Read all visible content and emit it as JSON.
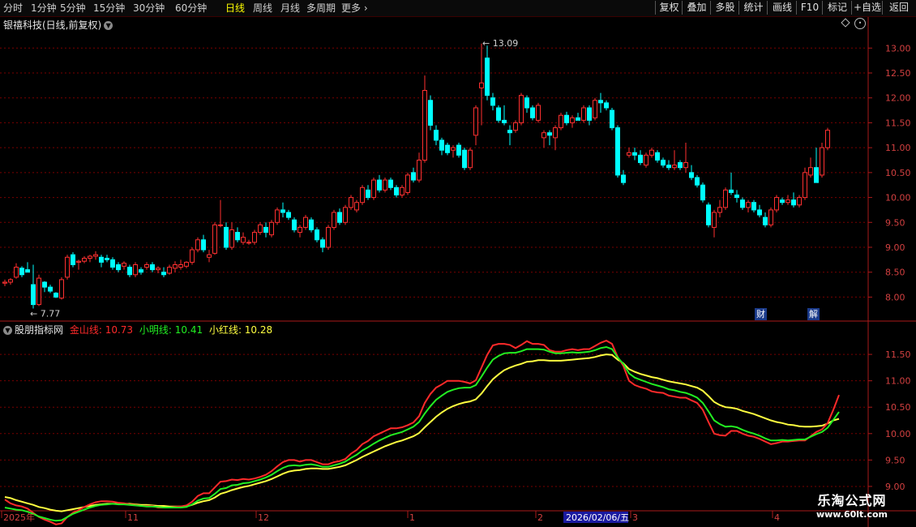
{
  "toolbar": {
    "periods": [
      "分时",
      "1分钟",
      "5分钟",
      "15分钟",
      "30分钟",
      "60分钟",
      "日线",
      "周线",
      "月线",
      "多周期",
      "更多"
    ],
    "active_period": "日线",
    "buttons": [
      "复权",
      "叠加",
      "多股",
      "统计",
      "画线",
      "F10",
      "标记",
      "+自选",
      "返回"
    ]
  },
  "stock": {
    "title": "银禧科技(日线,前复权)"
  },
  "price_axis": {
    "ticks": [
      "13.00",
      "12.50",
      "12.00",
      "11.50",
      "11.00",
      "10.50",
      "10.00",
      "9.50",
      "9.00",
      "8.50",
      "8.00"
    ],
    "min": 7.6,
    "max": 13.2
  },
  "annotations": {
    "high": "13.09",
    "low": "7.77"
  },
  "badges": [
    "财",
    "解"
  ],
  "indicator": {
    "name": "股朋指标网",
    "lines": [
      {
        "label": "金山线: 10.73",
        "color": "#ff2a2a"
      },
      {
        "label": "小明线: 10.41",
        "color": "#22ee22"
      },
      {
        "label": "小红线: 10.28",
        "color": "#ffff40"
      }
    ],
    "ticks": [
      "11.50",
      "11.00",
      "10.50",
      "10.00",
      "9.50",
      "9.00"
    ],
    "min": 8.6,
    "max": 12.1
  },
  "date_axis": {
    "labels": [
      "2025年",
      "11",
      "12",
      "1",
      "2",
      "3",
      "4"
    ],
    "cursor_date": "2026/02/06/五"
  },
  "watermark": {
    "line1": "乐淘公式网",
    "line2": "www.60lt.com"
  },
  "colors": {
    "up": "#ff3030",
    "down": "#00ffff",
    "grid": "#7a0000",
    "axis": "#aa1a1a"
  },
  "chart_data": {
    "type": "candlestick",
    "ohlc": [
      [
        8.28,
        8.35,
        8.22,
        8.3
      ],
      [
        8.3,
        8.38,
        8.25,
        8.35
      ],
      [
        8.4,
        8.68,
        8.37,
        8.6
      ],
      [
        8.58,
        8.62,
        8.4,
        8.45
      ],
      [
        8.55,
        8.7,
        8.5,
        8.5
      ],
      [
        8.25,
        8.65,
        7.77,
        7.85
      ],
      [
        7.85,
        8.45,
        7.82,
        8.38
      ],
      [
        8.3,
        8.32,
        8.1,
        8.2
      ],
      [
        8.2,
        8.25,
        8.08,
        8.12
      ],
      [
        8.08,
        8.1,
        7.98,
        8.0
      ],
      [
        7.98,
        8.4,
        7.95,
        8.35
      ],
      [
        8.4,
        8.85,
        8.35,
        8.8
      ],
      [
        8.85,
        8.9,
        8.6,
        8.65
      ],
      [
        8.7,
        8.75,
        8.55,
        8.72
      ],
      [
        8.72,
        8.82,
        8.68,
        8.78
      ],
      [
        8.78,
        8.85,
        8.7,
        8.82
      ],
      [
        8.82,
        8.92,
        8.75,
        8.85
      ],
      [
        8.8,
        8.85,
        8.6,
        8.7
      ],
      [
        8.78,
        8.85,
        8.7,
        8.75
      ],
      [
        8.75,
        8.8,
        8.55,
        8.6
      ],
      [
        8.65,
        8.7,
        8.5,
        8.55
      ],
      [
        8.62,
        8.72,
        8.55,
        8.68
      ],
      [
        8.6,
        8.65,
        8.4,
        8.45
      ],
      [
        8.45,
        8.7,
        8.4,
        8.65
      ],
      [
        8.55,
        8.6,
        8.45,
        8.5
      ],
      [
        8.6,
        8.7,
        8.55,
        8.65
      ],
      [
        8.65,
        8.7,
        8.5,
        8.55
      ],
      [
        8.55,
        8.62,
        8.48,
        8.58
      ],
      [
        8.5,
        8.6,
        8.4,
        8.45
      ],
      [
        8.48,
        8.65,
        8.45,
        8.6
      ],
      [
        8.58,
        8.72,
        8.5,
        8.65
      ],
      [
        8.6,
        8.75,
        8.55,
        8.65
      ],
      [
        8.62,
        8.72,
        8.58,
        8.7
      ],
      [
        8.7,
        9.0,
        8.65,
        8.95
      ],
      [
        8.95,
        9.2,
        8.9,
        9.15
      ],
      [
        9.15,
        9.25,
        8.9,
        8.95
      ],
      [
        8.8,
        8.95,
        8.7,
        8.85
      ],
      [
        8.88,
        9.5,
        8.85,
        9.45
      ],
      [
        9.45,
        9.95,
        9.4,
        9.45
      ],
      [
        9.4,
        9.5,
        8.95,
        9.0
      ],
      [
        9.0,
        9.5,
        8.95,
        9.35
      ],
      [
        9.3,
        9.4,
        9.1,
        9.15
      ],
      [
        9.1,
        9.3,
        9.05,
        9.2
      ],
      [
        9.1,
        9.15,
        9.05,
        9.1
      ],
      [
        9.1,
        9.35,
        9.05,
        9.3
      ],
      [
        9.3,
        9.5,
        9.25,
        9.45
      ],
      [
        9.4,
        9.5,
        9.2,
        9.3
      ],
      [
        9.25,
        9.55,
        9.2,
        9.5
      ],
      [
        9.5,
        9.8,
        9.45,
        9.75
      ],
      [
        9.75,
        9.9,
        9.6,
        9.7
      ],
      [
        9.7,
        9.75,
        9.55,
        9.6
      ],
      [
        9.55,
        9.6,
        9.3,
        9.35
      ],
      [
        9.3,
        9.45,
        9.2,
        9.4
      ],
      [
        9.4,
        9.65,
        9.35,
        9.6
      ],
      [
        9.55,
        9.6,
        9.3,
        9.35
      ],
      [
        9.35,
        9.4,
        9.1,
        9.15
      ],
      [
        9.15,
        9.2,
        8.9,
        9.0
      ],
      [
        9.0,
        9.45,
        8.95,
        9.4
      ],
      [
        9.4,
        9.75,
        9.35,
        9.7
      ],
      [
        9.7,
        9.78,
        9.45,
        9.5
      ],
      [
        9.5,
        9.85,
        9.45,
        9.8
      ],
      [
        9.8,
        10.05,
        9.75,
        10.0
      ],
      [
        9.75,
        9.95,
        9.7,
        9.9
      ],
      [
        9.9,
        10.25,
        9.85,
        10.2
      ],
      [
        10.15,
        10.25,
        9.95,
        10.0
      ],
      [
        10.0,
        10.4,
        9.95,
        10.35
      ],
      [
        10.35,
        10.45,
        10.1,
        10.15
      ],
      [
        10.15,
        10.4,
        10.1,
        10.35
      ],
      [
        10.35,
        10.4,
        10.15,
        10.2
      ],
      [
        10.2,
        10.25,
        10.0,
        10.05
      ],
      [
        10.05,
        10.25,
        10.0,
        10.2
      ],
      [
        10.1,
        10.5,
        10.05,
        10.45
      ],
      [
        10.5,
        10.6,
        10.3,
        10.35
      ],
      [
        10.35,
        10.9,
        10.3,
        10.75
      ],
      [
        10.75,
        12.45,
        10.7,
        12.15
      ],
      [
        11.95,
        12.05,
        11.35,
        11.45
      ],
      [
        11.35,
        11.45,
        11.05,
        11.15
      ],
      [
        11.15,
        11.2,
        10.85,
        10.95
      ],
      [
        11.05,
        11.1,
        10.85,
        10.9
      ],
      [
        10.95,
        11.05,
        10.8,
        11.0
      ],
      [
        11.05,
        11.1,
        10.8,
        10.85
      ],
      [
        10.95,
        11.0,
        10.55,
        10.6
      ],
      [
        10.6,
        11.0,
        10.55,
        10.95
      ],
      [
        11.25,
        11.85,
        11.05,
        11.8
      ],
      [
        12.2,
        13.09,
        11.45,
        12.3
      ],
      [
        12.8,
        13.05,
        11.95,
        12.05
      ],
      [
        12.0,
        12.1,
        11.75,
        11.85
      ],
      [
        11.8,
        11.85,
        11.5,
        11.55
      ],
      [
        11.55,
        11.85,
        11.45,
        11.5
      ],
      [
        11.35,
        11.45,
        11.05,
        11.3
      ],
      [
        11.35,
        11.55,
        11.3,
        11.5
      ],
      [
        11.5,
        12.1,
        11.45,
        12.05
      ],
      [
        12.0,
        12.05,
        11.7,
        11.8
      ],
      [
        11.8,
        11.85,
        11.55,
        11.6
      ],
      [
        11.55,
        11.9,
        11.5,
        11.85
      ],
      [
        11.2,
        11.35,
        11.0,
        11.3
      ],
      [
        11.3,
        11.35,
        11.05,
        11.25
      ],
      [
        11.2,
        11.45,
        10.95,
        11.4
      ],
      [
        11.4,
        11.7,
        11.35,
        11.65
      ],
      [
        11.65,
        11.72,
        11.45,
        11.5
      ],
      [
        11.5,
        11.65,
        11.4,
        11.6
      ],
      [
        11.6,
        11.7,
        11.55,
        11.55
      ],
      [
        11.55,
        11.85,
        11.5,
        11.8
      ],
      [
        11.8,
        11.85,
        11.45,
        11.55
      ],
      [
        11.6,
        12.0,
        11.55,
        11.95
      ],
      [
        11.95,
        12.1,
        11.7,
        11.9
      ],
      [
        11.9,
        11.95,
        11.75,
        11.8
      ],
      [
        11.75,
        11.8,
        11.35,
        11.4
      ],
      [
        11.4,
        11.45,
        10.4,
        10.45
      ],
      [
        10.45,
        10.55,
        10.25,
        10.3
      ],
      [
        10.85,
        11.0,
        10.8,
        10.9
      ],
      [
        10.9,
        11.0,
        10.75,
        10.85
      ],
      [
        10.85,
        10.95,
        10.65,
        10.7
      ],
      [
        10.65,
        10.9,
        10.6,
        10.85
      ],
      [
        10.85,
        11.0,
        10.8,
        10.95
      ],
      [
        10.9,
        10.95,
        10.7,
        10.75
      ],
      [
        10.75,
        10.8,
        10.6,
        10.65
      ],
      [
        10.65,
        10.75,
        10.55,
        10.6
      ],
      [
        10.6,
        10.95,
        10.55,
        10.65
      ],
      [
        10.7,
        10.75,
        10.55,
        10.6
      ],
      [
        10.6,
        11.1,
        10.5,
        10.7
      ],
      [
        10.5,
        10.65,
        10.35,
        10.4
      ],
      [
        10.4,
        10.45,
        10.2,
        10.25
      ],
      [
        10.25,
        10.3,
        9.9,
        9.95
      ],
      [
        9.85,
        9.9,
        9.4,
        9.45
      ],
      [
        9.4,
        9.75,
        9.2,
        9.7
      ],
      [
        9.7,
        9.95,
        9.6,
        9.8
      ],
      [
        9.8,
        10.2,
        9.75,
        10.15
      ],
      [
        10.15,
        10.5,
        10.05,
        10.1
      ],
      [
        10.05,
        10.15,
        9.9,
        10.0
      ],
      [
        9.95,
        10.0,
        9.75,
        9.8
      ],
      [
        9.8,
        9.95,
        9.7,
        9.9
      ],
      [
        9.9,
        9.95,
        9.7,
        9.75
      ],
      [
        9.75,
        9.85,
        9.6,
        9.65
      ],
      [
        9.6,
        9.7,
        9.4,
        9.45
      ],
      [
        9.45,
        9.8,
        9.4,
        9.75
      ],
      [
        9.75,
        10.05,
        9.7,
        10.0
      ],
      [
        9.95,
        10.0,
        9.85,
        9.9
      ],
      [
        9.9,
        10.05,
        9.85,
        9.95
      ],
      [
        9.95,
        10.1,
        9.8,
        9.85
      ],
      [
        9.85,
        10.05,
        9.8,
        10.0
      ],
      [
        10.0,
        10.6,
        9.95,
        10.5
      ],
      [
        10.45,
        10.8,
        10.4,
        10.6
      ],
      [
        10.6,
        11.0,
        10.3,
        10.3
      ],
      [
        10.45,
        11.1,
        10.4,
        11.0
      ],
      [
        11.0,
        11.4,
        10.95,
        11.35
      ]
    ],
    "ind_gold": [
      8.75,
      8.68,
      8.64,
      8.62,
      8.58,
      8.5,
      8.42,
      8.37,
      8.33,
      8.28,
      8.3,
      8.42,
      8.5,
      8.55,
      8.61,
      8.66,
      8.7,
      8.72,
      8.72,
      8.71,
      8.69,
      8.68,
      8.66,
      8.65,
      8.63,
      8.63,
      8.63,
      8.6,
      8.6,
      8.6,
      8.61,
      8.62,
      8.64,
      8.71,
      8.82,
      8.87,
      8.87,
      8.98,
      9.09,
      9.1,
      9.13,
      9.12,
      9.14,
      9.13,
      9.15,
      9.18,
      9.22,
      9.29,
      9.38,
      9.46,
      9.5,
      9.5,
      9.47,
      9.5,
      9.5,
      9.46,
      9.42,
      9.42,
      9.46,
      9.48,
      9.52,
      9.62,
      9.69,
      9.8,
      9.86,
      9.95,
      10.0,
      10.05,
      10.1,
      10.1,
      10.12,
      10.16,
      10.21,
      10.33,
      10.58,
      10.75,
      10.87,
      10.93,
      11.0,
      11.0,
      11.0,
      10.98,
      10.95,
      11.01,
      11.25,
      11.49,
      11.67,
      11.7,
      11.7,
      11.68,
      11.62,
      11.68,
      11.75,
      11.7,
      11.7,
      11.68,
      11.58,
      11.55,
      11.55,
      11.58,
      11.6,
      11.58,
      11.6,
      11.6,
      11.66,
      11.72,
      11.76,
      11.7,
      11.45,
      11.28,
      11.0,
      10.92,
      10.88,
      10.85,
      10.8,
      10.78,
      10.77,
      10.72,
      10.7,
      10.68,
      10.68,
      10.63,
      10.58,
      10.45,
      10.22,
      10.0,
      9.97,
      9.96,
      10.05,
      10.05,
      10.0,
      9.96,
      9.94,
      9.9,
      9.85,
      9.8,
      9.82,
      9.85,
      9.85,
      9.86,
      9.87,
      9.87,
      9.95,
      10.03,
      10.08,
      10.2,
      10.45,
      10.73
    ],
    "ind_green": [
      8.6,
      8.58,
      8.56,
      8.55,
      8.52,
      8.48,
      8.43,
      8.4,
      8.37,
      8.35,
      8.36,
      8.42,
      8.48,
      8.52,
      8.56,
      8.6,
      8.63,
      8.65,
      8.66,
      8.67,
      8.66,
      8.66,
      8.65,
      8.64,
      8.63,
      8.62,
      8.62,
      8.61,
      8.6,
      8.6,
      8.6,
      8.6,
      8.61,
      8.66,
      8.73,
      8.77,
      8.78,
      8.86,
      8.95,
      8.97,
      9.02,
      9.03,
      9.06,
      9.07,
      9.1,
      9.13,
      9.17,
      9.22,
      9.29,
      9.35,
      9.39,
      9.4,
      9.39,
      9.41,
      9.42,
      9.4,
      9.37,
      9.37,
      9.4,
      9.43,
      9.47,
      9.54,
      9.6,
      9.68,
      9.74,
      9.81,
      9.87,
      9.92,
      9.97,
      10.0,
      10.03,
      10.08,
      10.13,
      10.22,
      10.38,
      10.52,
      10.64,
      10.72,
      10.79,
      10.83,
      10.86,
      10.87,
      10.87,
      10.92,
      11.08,
      11.25,
      11.4,
      11.47,
      11.52,
      11.53,
      11.53,
      11.56,
      11.6,
      11.6,
      11.6,
      11.59,
      11.55,
      11.52,
      11.52,
      11.53,
      11.54,
      11.53,
      11.54,
      11.55,
      11.58,
      11.62,
      11.64,
      11.6,
      11.44,
      11.32,
      11.14,
      11.06,
      11.02,
      10.98,
      10.94,
      10.91,
      10.88,
      10.84,
      10.82,
      10.79,
      10.77,
      10.73,
      10.68,
      10.58,
      10.42,
      10.25,
      10.18,
      10.13,
      10.14,
      10.12,
      10.07,
      10.03,
      10.0,
      9.96,
      9.91,
      9.87,
      9.87,
      9.88,
      9.87,
      9.88,
      9.89,
      9.89,
      9.94,
      9.99,
      10.03,
      10.11,
      10.26,
      10.41
    ],
    "ind_yellow": [
      8.8,
      8.78,
      8.74,
      8.71,
      8.68,
      8.65,
      8.61,
      8.59,
      8.56,
      8.54,
      8.53,
      8.55,
      8.57,
      8.59,
      8.61,
      8.63,
      8.65,
      8.66,
      8.67,
      8.67,
      8.67,
      8.67,
      8.67,
      8.66,
      8.65,
      8.65,
      8.64,
      8.63,
      8.63,
      8.62,
      8.62,
      8.62,
      8.62,
      8.65,
      8.69,
      8.72,
      8.74,
      8.79,
      8.86,
      8.89,
      8.93,
      8.96,
      8.99,
      9.01,
      9.04,
      9.07,
      9.1,
      9.14,
      9.19,
      9.24,
      9.28,
      9.3,
      9.31,
      9.33,
      9.34,
      9.34,
      9.33,
      9.33,
      9.35,
      9.37,
      9.4,
      9.45,
      9.5,
      9.56,
      9.61,
      9.66,
      9.71,
      9.76,
      9.8,
      9.84,
      9.87,
      9.91,
      9.95,
      10.01,
      10.12,
      10.22,
      10.32,
      10.4,
      10.47,
      10.52,
      10.56,
      10.59,
      10.61,
      10.65,
      10.76,
      10.9,
      11.03,
      11.12,
      11.2,
      11.25,
      11.29,
      11.32,
      11.36,
      11.37,
      11.39,
      11.39,
      11.38,
      11.38,
      11.38,
      11.39,
      11.4,
      11.41,
      11.42,
      11.43,
      11.45,
      11.48,
      11.5,
      11.49,
      11.4,
      11.33,
      11.22,
      11.17,
      11.13,
      11.1,
      11.07,
      11.05,
      11.02,
      10.99,
      10.97,
      10.95,
      10.93,
      10.9,
      10.87,
      10.81,
      10.71,
      10.6,
      10.54,
      10.5,
      10.49,
      10.47,
      10.43,
      10.4,
      10.37,
      10.33,
      10.29,
      10.25,
      10.22,
      10.2,
      10.17,
      10.16,
      10.14,
      10.13,
      10.13,
      10.14,
      10.15,
      10.19,
      10.25,
      10.28
    ]
  }
}
